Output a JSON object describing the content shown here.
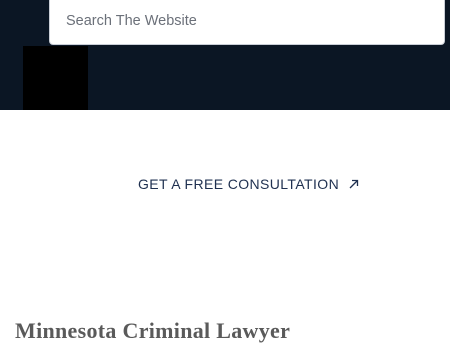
{
  "header": {
    "search": {
      "placeholder": "Search The Website"
    }
  },
  "cta": {
    "label": "GET A FREE CONSULTATION",
    "icon": "arrow-up-right-icon"
  },
  "main": {
    "heading": "Minnesota Criminal Lawyer"
  },
  "colors": {
    "header_bg": "#0b1624",
    "cta_text": "#1f3050",
    "heading_text": "#5a5a5a"
  }
}
